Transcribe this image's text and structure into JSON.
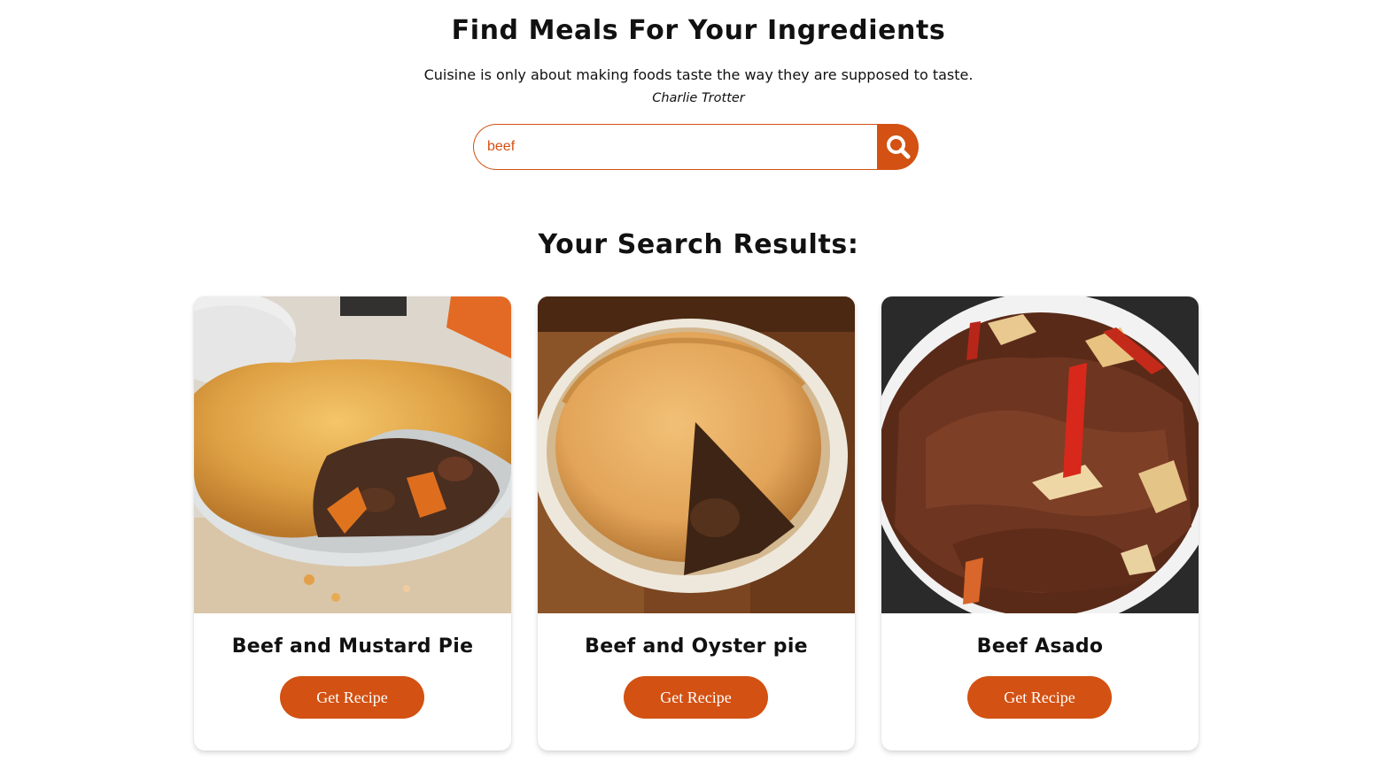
{
  "header": {
    "title": "Find Meals For Your Ingredients",
    "quote": "Cuisine is only about making foods taste the way they are supposed to taste.",
    "author": "Charlie Trotter"
  },
  "search": {
    "value": "beef",
    "icon": "search-icon"
  },
  "results": {
    "heading": "Your Search Results:",
    "cards": [
      {
        "title": "Beef and Mustard Pie",
        "button_label": "Get Recipe",
        "image": "beef-mustard-pie-photo"
      },
      {
        "title": "Beef and Oyster pie",
        "button_label": "Get Recipe",
        "image": "beef-oyster-pie-photo"
      },
      {
        "title": "Beef Asado",
        "button_label": "Get Recipe",
        "image": "beef-asado-photo"
      }
    ]
  },
  "colors": {
    "accent": "#d35112",
    "text": "#111111",
    "background": "#ffffff"
  }
}
